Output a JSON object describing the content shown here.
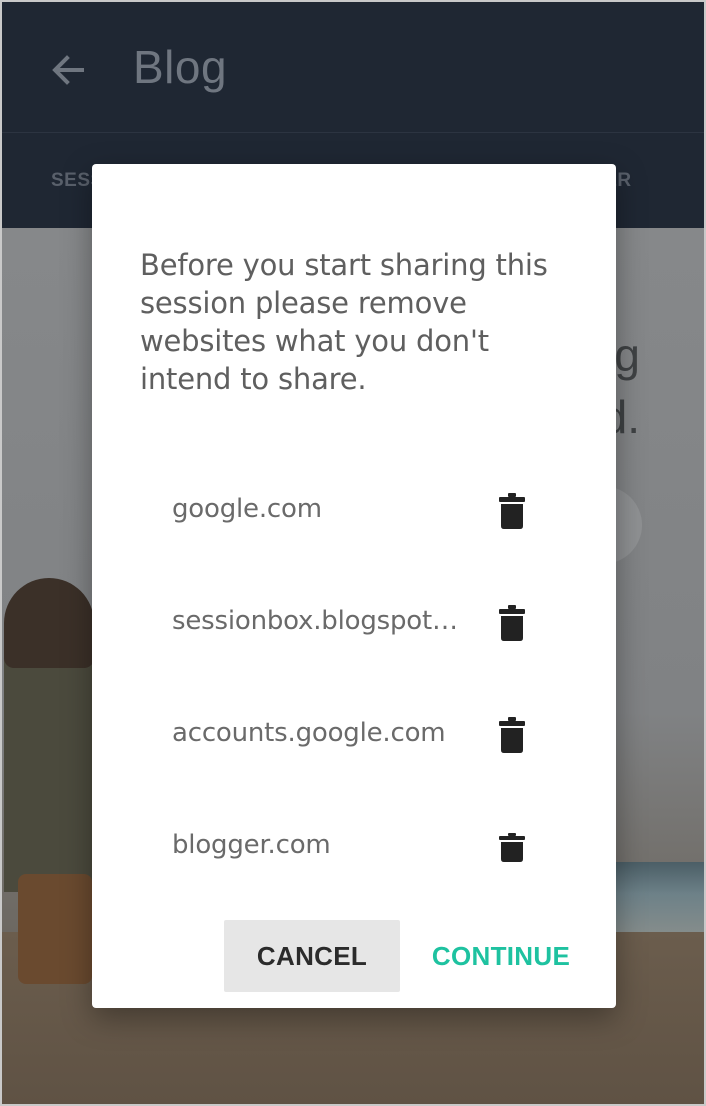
{
  "header": {
    "title": "Blog",
    "back_icon": "arrow-back-icon",
    "tab_left": "SESS",
    "tab_right": "HER"
  },
  "background": {
    "headline": "g\nd."
  },
  "dialog": {
    "message": "Before you start sharing this session please remove websites what you don't intend to share.",
    "sites": [
      {
        "label": "google.com",
        "icon": "trash-icon"
      },
      {
        "label": "sessionbox.blogspot.com",
        "icon": "trash-icon"
      },
      {
        "label": "accounts.google.com",
        "icon": "trash-icon"
      },
      {
        "label": "blogger.com",
        "icon": "trash-icon"
      }
    ],
    "cancel_label": "CANCEL",
    "continue_label": "CONTINUE"
  },
  "colors": {
    "appbar": "#1f2733",
    "accent": "#1ec2a0",
    "cancel_bg": "#e6e6e6"
  }
}
